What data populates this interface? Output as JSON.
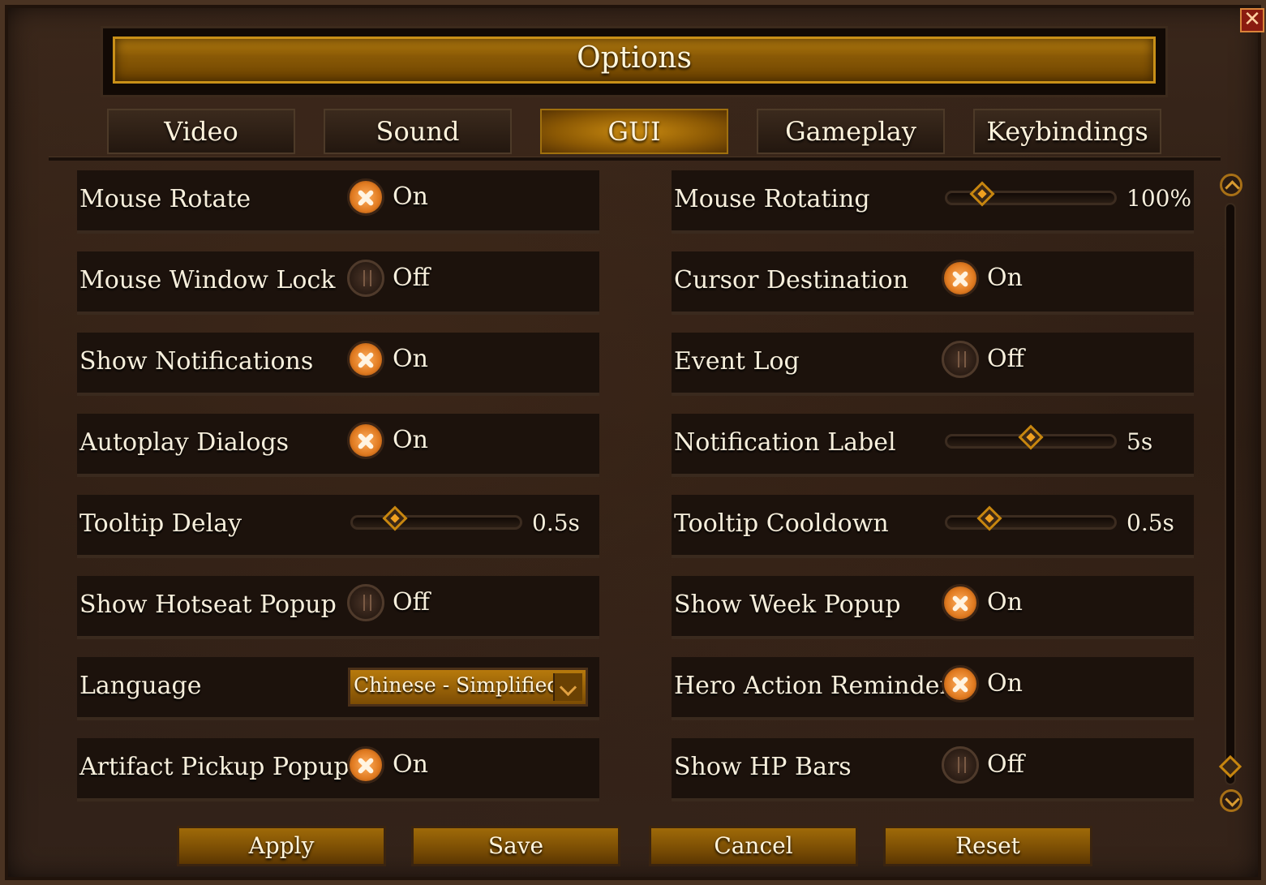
{
  "window": {
    "title": "Options",
    "close_glyph": "✕"
  },
  "tabs": [
    {
      "label": "Video",
      "active": false
    },
    {
      "label": "Sound",
      "active": false
    },
    {
      "label": "GUI",
      "active": true
    },
    {
      "label": "Gameplay",
      "active": false
    },
    {
      "label": "Keybindings",
      "active": false
    }
  ],
  "left": [
    {
      "label": "Mouse Rotate",
      "type": "toggle",
      "state": "On"
    },
    {
      "label": "Mouse Window Lock",
      "type": "toggle",
      "state": "Off"
    },
    {
      "label": "Show Notifications",
      "type": "toggle",
      "state": "On"
    },
    {
      "label": "Autoplay Dialogs",
      "type": "toggle",
      "state": "On"
    },
    {
      "label": "Tooltip Delay",
      "type": "slider",
      "value": "0.5s",
      "level": 0.25
    },
    {
      "label": "Show Hotseat Popup",
      "type": "toggle",
      "state": "Off"
    },
    {
      "label": "Language",
      "type": "dropdown",
      "value": "Chinese - Simplified"
    },
    {
      "label": "Artifact Pickup Popup",
      "type": "toggle",
      "state": "On"
    }
  ],
  "right": [
    {
      "label": "Mouse Rotating",
      "type": "slider",
      "value": "100%",
      "level": 0.21
    },
    {
      "label": "Cursor Destination",
      "type": "toggle",
      "state": "On"
    },
    {
      "label": "Event Log",
      "type": "toggle",
      "state": "Off"
    },
    {
      "label": "Notification Label",
      "type": "slider",
      "value": "5s",
      "level": 0.5
    },
    {
      "label": "Tooltip Cooldown",
      "type": "slider",
      "value": "0.5s",
      "level": 0.25
    },
    {
      "label": "Show Week Popup",
      "type": "toggle",
      "state": "On"
    },
    {
      "label": "Hero Action Reminder",
      "type": "toggle",
      "state": "On"
    },
    {
      "label": "Show HP Bars",
      "type": "toggle",
      "state": "Off"
    }
  ],
  "buttons": {
    "apply": "Apply",
    "save": "Save",
    "cancel": "Cancel",
    "reset": "Reset"
  },
  "colors": {
    "accent_gold": "#c98a10",
    "toggle_on": "#e07a20",
    "background": "#2b1c13",
    "text": "#f7efdc"
  }
}
